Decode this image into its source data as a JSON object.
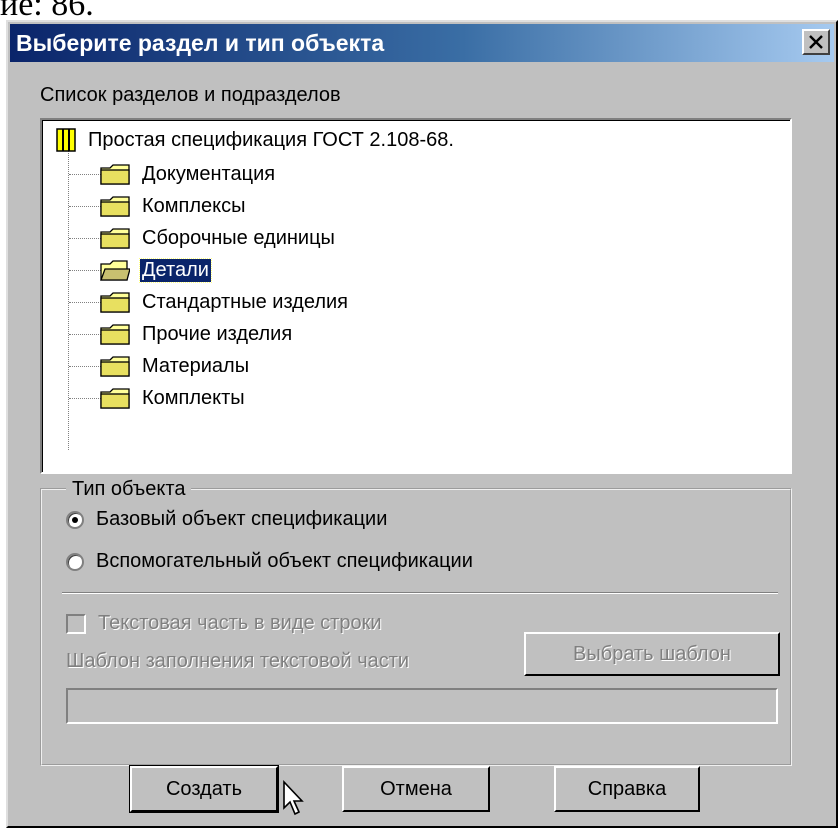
{
  "caption_fragment": "ие: 86.",
  "dialog": {
    "title": "Выберите раздел и тип объекта",
    "sections_label": "Список разделов и подразделов",
    "tree": {
      "root": "Простая спецификация ГОСТ 2.108-68.",
      "items": [
        {
          "label": "Документация",
          "selected": false
        },
        {
          "label": "Комплексы",
          "selected": false
        },
        {
          "label": "Сборочные единицы",
          "selected": false
        },
        {
          "label": "Детали",
          "selected": true
        },
        {
          "label": "Стандартные изделия",
          "selected": false
        },
        {
          "label": "Прочие изделия",
          "selected": false
        },
        {
          "label": "Материалы",
          "selected": false
        },
        {
          "label": "Комплекты",
          "selected": false
        }
      ]
    },
    "object_type": {
      "legend": "Тип объекта",
      "base_option": "Базовый объект спецификации",
      "aux_option": "Вспомогательный объект спецификации",
      "selected": "base",
      "text_part_checkbox": "Текстовая часть в виде строки",
      "template_label": "Шаблон заполнения текстовой части",
      "choose_template_button": "Выбрать шаблон",
      "template_value": ""
    },
    "buttons": {
      "create": "Создать",
      "cancel": "Отмена",
      "help": "Справка"
    }
  }
}
